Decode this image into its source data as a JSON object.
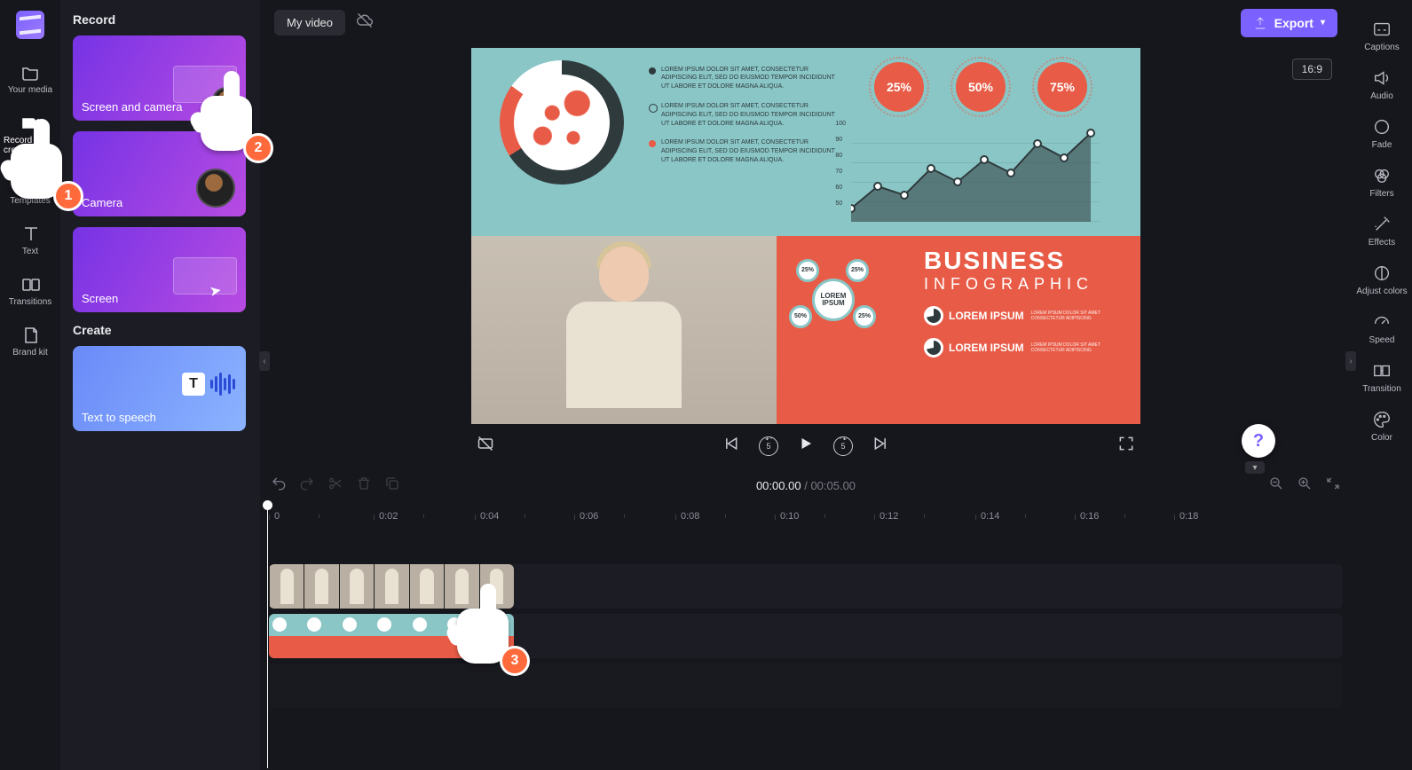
{
  "topbar": {
    "title": "My video",
    "export_label": "Export",
    "aspect": "16:9"
  },
  "left_rail": {
    "your_media": "Your media",
    "record_create": "Record & create",
    "templates": "Templates",
    "text": "Text",
    "transitions": "Transitions",
    "brand_kit": "Brand kit"
  },
  "side_panel": {
    "record_title": "Record",
    "create_title": "Create",
    "cards": {
      "screen_camera": "Screen and camera",
      "camera": "Camera",
      "screen": "Screen",
      "tts": "Text to speech"
    }
  },
  "right_rail": {
    "captions": "Captions",
    "audio": "Audio",
    "fade": "Fade",
    "filters": "Filters",
    "effects": "Effects",
    "adjust_colors": "Adjust colors",
    "speed": "Speed",
    "transition": "Transition",
    "color": "Color"
  },
  "preview": {
    "percent1": "25%",
    "percent2": "50%",
    "percent3": "75%",
    "yaxis": [
      "100",
      "90",
      "80",
      "70",
      "60",
      "50"
    ],
    "lorem": "LOREM IPSUM DOLOR SIT AMET, CONSECTETUR ADIPISCING ELIT, SED DO EIUSMOD TEMPOR INCIDIDUNT UT LABORE ET DOLORE MAGNA ALIQUA.",
    "biz_title": "BUSINESS",
    "biz_sub": "INFOGRAPHIC",
    "lorem_cap": "LOREM IPSUM",
    "lorem_small": "LOREM IPSUM DOLOR SIT AMET CONSECTETUR ADIPISCING",
    "bubble_center": "LOREM IPSUM",
    "bubble_pcts": [
      "25%",
      "25%",
      "50%",
      "25%"
    ]
  },
  "transport": {
    "skip_seconds": "5"
  },
  "timecode": {
    "current": "00:00.00",
    "separator": "/",
    "total": "00:05.00"
  },
  "timeline": {
    "ticks": [
      {
        "label": "0",
        "pos": 8
      },
      {
        "label": "0:02",
        "pos": 126
      },
      {
        "label": "0:04",
        "pos": 240
      },
      {
        "label": "0:06",
        "pos": 352
      },
      {
        "label": "0:08",
        "pos": 466
      },
      {
        "label": "0:10",
        "pos": 578
      },
      {
        "label": "0:12",
        "pos": 690
      },
      {
        "label": "0:14",
        "pos": 804
      },
      {
        "label": "0:16",
        "pos": 916
      },
      {
        "label": "0:18",
        "pos": 1028
      }
    ]
  },
  "callouts": {
    "n1": "1",
    "n2": "2",
    "n3": "3"
  },
  "help": "?"
}
